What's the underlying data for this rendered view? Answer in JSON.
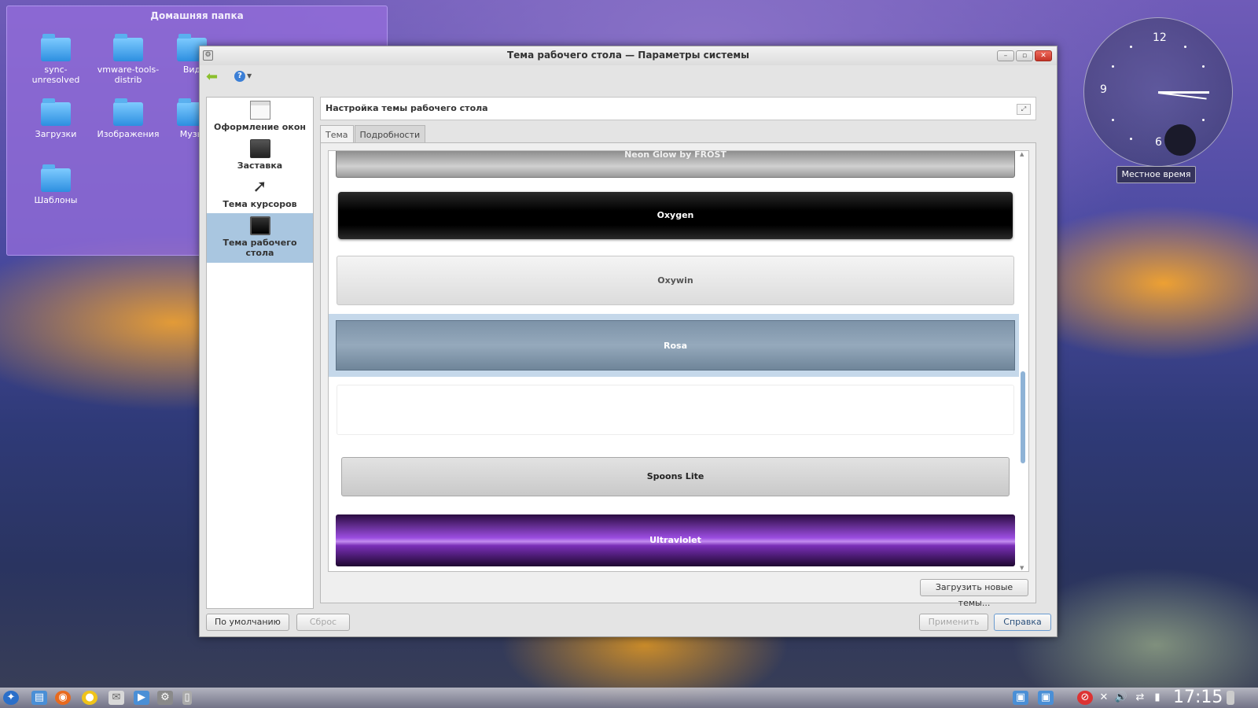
{
  "desktop": {
    "folderview": {
      "title": "Домашняя папка",
      "items": [
        {
          "label": "sync-\nunresolved",
          "line1": "sync-",
          "line2": "unresolved"
        },
        {
          "label": "vmware-tools-distrib",
          "line1": "vmware-tools-",
          "line2": "distrib"
        },
        {
          "label": "Вид",
          "line1": "Вид",
          "line2": ""
        },
        {
          "label": "Загрузки",
          "line1": "Загрузки",
          "line2": ""
        },
        {
          "label": "Изображения",
          "line1": "Изображения",
          "line2": ""
        },
        {
          "label": "Музы",
          "line1": "Музы",
          "line2": ""
        },
        {
          "label": "Шаблоны",
          "line1": "Шаблоны",
          "line2": ""
        }
      ]
    },
    "clock": {
      "numbers": {
        "twelve": "12",
        "nine": "9",
        "six": "6"
      },
      "label": "Местное время"
    }
  },
  "window": {
    "title": "Тема рабочего стола — Параметры системы",
    "buttons": {
      "minimize": "–",
      "maximize": "▫",
      "close": "✕"
    }
  },
  "sidebar": {
    "items": [
      {
        "label": "Оформление окон",
        "icon": "window-decoration-icon"
      },
      {
        "label": "Заставка",
        "icon": "screensaver-icon"
      },
      {
        "label": "Тема курсоров",
        "icon": "cursor-icon"
      },
      {
        "label": "Тема рабочего\nстола",
        "line1": "Тема рабочего",
        "line2": "стола",
        "icon": "desktop-theme-icon",
        "active": true
      }
    ]
  },
  "main": {
    "header_title": "Настройка темы рабочего стола",
    "tabs": [
      {
        "label": "Тема",
        "active": true
      },
      {
        "label": "Подробности",
        "active": false
      }
    ],
    "themes": [
      {
        "name": "Neon Glow by FROST"
      },
      {
        "name": "Oxygen"
      },
      {
        "name": "Oxywin"
      },
      {
        "name": "Rosa",
        "selected": true
      },
      {
        "name": ""
      },
      {
        "name": "Spoons Lite"
      },
      {
        "name": "Ultraviolet"
      }
    ],
    "get_new_themes": "Загрузить новые темы..."
  },
  "footer": {
    "defaults": "По умолчанию",
    "reset": "Сброс",
    "apply": "Применить",
    "help": "Справка"
  },
  "taskbar": {
    "time": "17:15"
  },
  "colors": {
    "selection": "#c5d8ea",
    "ultraviolet": "#9b4de0",
    "accent_blue": "#3b7fd6"
  }
}
